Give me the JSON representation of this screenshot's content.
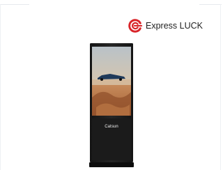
{
  "brand": {
    "name": "Express LUCK",
    "icon": "express-luck-logo-icon",
    "accent_color": "#d9252a"
  },
  "product": {
    "screen_brand": "Catsun",
    "body_color": "#1a1a1a"
  }
}
